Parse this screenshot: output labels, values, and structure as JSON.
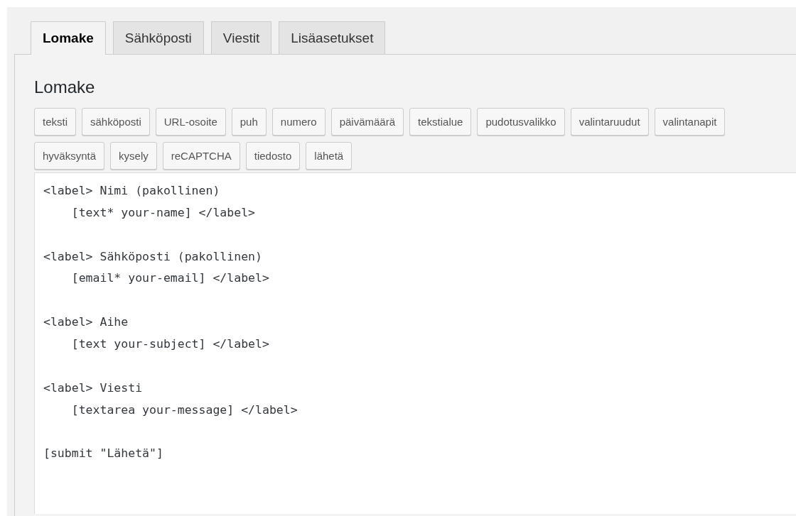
{
  "tabs": [
    {
      "label": "Lomake",
      "selected": true
    },
    {
      "label": "Sähköposti",
      "selected": false
    },
    {
      "label": "Viestit",
      "selected": false
    },
    {
      "label": "Lisäasetukset",
      "selected": false
    }
  ],
  "panel": {
    "title": "Lomake",
    "tag_buttons": [
      "teksti",
      "sähköposti",
      "URL-osoite",
      "puh",
      "numero",
      "päivämäärä",
      "tekstialue",
      "pudotusvalikko",
      "valintaruudut",
      "valintanapit",
      "hyväksyntä",
      "kysely",
      "reCAPTCHA",
      "tiedosto",
      "lähetä"
    ],
    "editor_blocks": [
      [
        "<label> Nimi (pakollinen)",
        "    [text* your-name] </label>"
      ],
      [
        "<label> Sähköposti (pakollinen)",
        "    [email* your-email] </label>"
      ],
      [
        "<label> Aihe",
        "    [text your-subject] </label>"
      ],
      [
        "<label> Viesti",
        "    [textarea your-message] </label>"
      ],
      [
        "[submit \"Lähetä\"]"
      ]
    ]
  }
}
